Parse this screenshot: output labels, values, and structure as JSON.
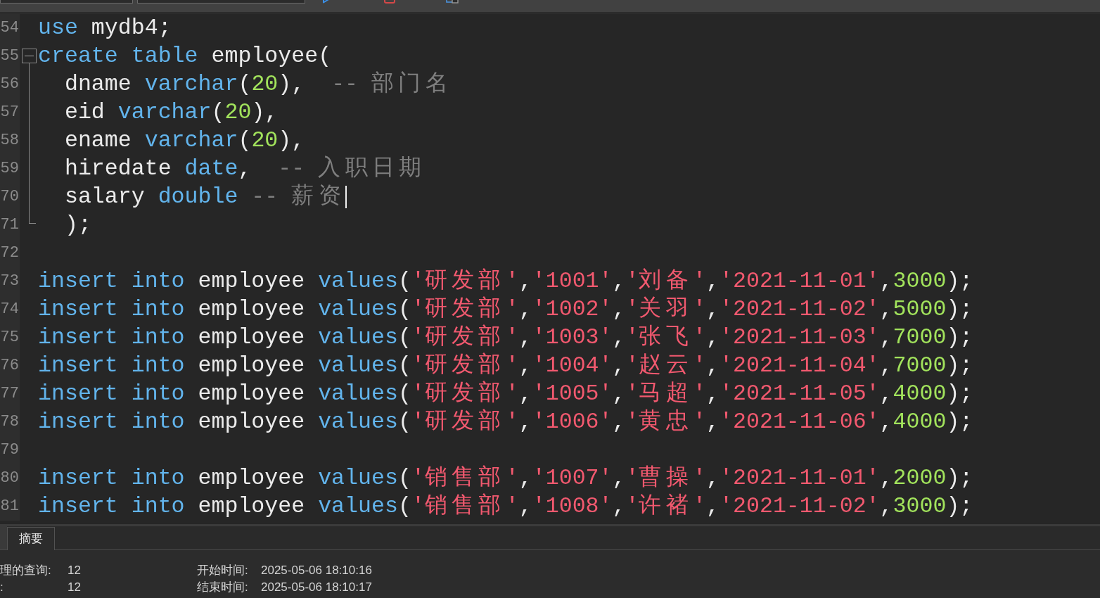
{
  "toolbar": {
    "fields": [
      {
        "kind": "select"
      },
      {
        "kind": "select"
      }
    ],
    "buttons": [
      {
        "kind": "run"
      },
      {
        "kind": "stop"
      },
      {
        "kind": "explain"
      }
    ]
  },
  "editor": {
    "lines": [
      {
        "number": "54",
        "kind": "plain",
        "tokens": [
          {
            "kind": "keyword",
            "text": "use"
          },
          {
            "kind": "plain",
            "text": " mydb4;"
          }
        ]
      },
      {
        "number": "55",
        "kind": "foldstart",
        "tokens": [
          {
            "kind": "keyword",
            "text": "create"
          },
          {
            "kind": "keyword",
            "text": " table"
          },
          {
            "kind": "plain",
            "text": " employee("
          }
        ]
      },
      {
        "number": "56",
        "kind": "foldbody",
        "tokens": [
          {
            "kind": "plain",
            "text": "  dname "
          },
          {
            "kind": "keyword",
            "text": "varchar"
          },
          {
            "kind": "plain",
            "text": "("
          },
          {
            "kind": "number",
            "text": "20"
          },
          {
            "kind": "plain",
            "text": "),  "
          },
          {
            "kind": "comment",
            "text": "-- 部门名"
          }
        ]
      },
      {
        "number": "57",
        "kind": "foldbody",
        "tokens": [
          {
            "kind": "plain",
            "text": "  eid "
          },
          {
            "kind": "keyword",
            "text": "varchar"
          },
          {
            "kind": "plain",
            "text": "("
          },
          {
            "kind": "number",
            "text": "20"
          },
          {
            "kind": "plain",
            "text": "),"
          }
        ]
      },
      {
        "number": "58",
        "kind": "foldbody",
        "tokens": [
          {
            "kind": "plain",
            "text": "  ename "
          },
          {
            "kind": "keyword",
            "text": "varchar"
          },
          {
            "kind": "plain",
            "text": "("
          },
          {
            "kind": "number",
            "text": "20"
          },
          {
            "kind": "plain",
            "text": "),"
          }
        ]
      },
      {
        "number": "59",
        "kind": "foldbody",
        "tokens": [
          {
            "kind": "plain",
            "text": "  hiredate "
          },
          {
            "kind": "keyword",
            "text": "date"
          },
          {
            "kind": "plain",
            "text": ",  "
          },
          {
            "kind": "comment",
            "text": "-- 入职日期"
          }
        ]
      },
      {
        "number": "70",
        "kind": "foldbody",
        "tokens": [
          {
            "kind": "plain",
            "text": "  salary "
          },
          {
            "kind": "keyword",
            "text": "double"
          },
          {
            "kind": "comment",
            "text": " -- 薪资"
          },
          {
            "kind": "cursor"
          }
        ]
      },
      {
        "number": "71",
        "kind": "foldend",
        "tokens": [
          {
            "kind": "plain",
            "text": "  );"
          }
        ]
      },
      {
        "number": "72",
        "kind": "plain"
      },
      {
        "number": "73",
        "kind": "plain",
        "tokens": [
          {
            "kind": "keyword",
            "text": "insert"
          },
          {
            "kind": "keyword",
            "text": " into"
          },
          {
            "kind": "plain",
            "text": " employee "
          },
          {
            "kind": "keyword",
            "text": "values"
          },
          {
            "kind": "plain",
            "text": "("
          },
          {
            "kind": "string",
            "text": "'研发部'"
          },
          {
            "kind": "plain",
            "text": ","
          },
          {
            "kind": "string",
            "text": "'1001'"
          },
          {
            "kind": "plain",
            "text": ","
          },
          {
            "kind": "string",
            "text": "'刘备'"
          },
          {
            "kind": "plain",
            "text": ","
          },
          {
            "kind": "string",
            "text": "'2021-11-01'"
          },
          {
            "kind": "plain",
            "text": ","
          },
          {
            "kind": "number",
            "text": "3000"
          },
          {
            "kind": "plain",
            "text": ");"
          }
        ]
      },
      {
        "number": "74",
        "kind": "plain",
        "tokens": [
          {
            "kind": "keyword",
            "text": "insert"
          },
          {
            "kind": "keyword",
            "text": " into"
          },
          {
            "kind": "plain",
            "text": " employee "
          },
          {
            "kind": "keyword",
            "text": "values"
          },
          {
            "kind": "plain",
            "text": "("
          },
          {
            "kind": "string",
            "text": "'研发部'"
          },
          {
            "kind": "plain",
            "text": ","
          },
          {
            "kind": "string",
            "text": "'1002'"
          },
          {
            "kind": "plain",
            "text": ","
          },
          {
            "kind": "string",
            "text": "'关羽'"
          },
          {
            "kind": "plain",
            "text": ","
          },
          {
            "kind": "string",
            "text": "'2021-11-02'"
          },
          {
            "kind": "plain",
            "text": ","
          },
          {
            "kind": "number",
            "text": "5000"
          },
          {
            "kind": "plain",
            "text": ");"
          }
        ]
      },
      {
        "number": "75",
        "kind": "plain",
        "tokens": [
          {
            "kind": "keyword",
            "text": "insert"
          },
          {
            "kind": "keyword",
            "text": " into"
          },
          {
            "kind": "plain",
            "text": " employee "
          },
          {
            "kind": "keyword",
            "text": "values"
          },
          {
            "kind": "plain",
            "text": "("
          },
          {
            "kind": "string",
            "text": "'研发部'"
          },
          {
            "kind": "plain",
            "text": ","
          },
          {
            "kind": "string",
            "text": "'1003'"
          },
          {
            "kind": "plain",
            "text": ","
          },
          {
            "kind": "string",
            "text": "'张飞'"
          },
          {
            "kind": "plain",
            "text": ","
          },
          {
            "kind": "string",
            "text": "'2021-11-03'"
          },
          {
            "kind": "plain",
            "text": ","
          },
          {
            "kind": "number",
            "text": "7000"
          },
          {
            "kind": "plain",
            "text": ");"
          }
        ]
      },
      {
        "number": "76",
        "kind": "plain",
        "tokens": [
          {
            "kind": "keyword",
            "text": "insert"
          },
          {
            "kind": "keyword",
            "text": " into"
          },
          {
            "kind": "plain",
            "text": " employee "
          },
          {
            "kind": "keyword",
            "text": "values"
          },
          {
            "kind": "plain",
            "text": "("
          },
          {
            "kind": "string",
            "text": "'研发部'"
          },
          {
            "kind": "plain",
            "text": ","
          },
          {
            "kind": "string",
            "text": "'1004'"
          },
          {
            "kind": "plain",
            "text": ","
          },
          {
            "kind": "string",
            "text": "'赵云'"
          },
          {
            "kind": "plain",
            "text": ","
          },
          {
            "kind": "string",
            "text": "'2021-11-04'"
          },
          {
            "kind": "plain",
            "text": ","
          },
          {
            "kind": "number",
            "text": "7000"
          },
          {
            "kind": "plain",
            "text": ");"
          }
        ]
      },
      {
        "number": "77",
        "kind": "plain",
        "tokens": [
          {
            "kind": "keyword",
            "text": "insert"
          },
          {
            "kind": "keyword",
            "text": " into"
          },
          {
            "kind": "plain",
            "text": " employee "
          },
          {
            "kind": "keyword",
            "text": "values"
          },
          {
            "kind": "plain",
            "text": "("
          },
          {
            "kind": "string",
            "text": "'研发部'"
          },
          {
            "kind": "plain",
            "text": ","
          },
          {
            "kind": "string",
            "text": "'1005'"
          },
          {
            "kind": "plain",
            "text": ","
          },
          {
            "kind": "string",
            "text": "'马超'"
          },
          {
            "kind": "plain",
            "text": ","
          },
          {
            "kind": "string",
            "text": "'2021-11-05'"
          },
          {
            "kind": "plain",
            "text": ","
          },
          {
            "kind": "number",
            "text": "4000"
          },
          {
            "kind": "plain",
            "text": ");"
          }
        ]
      },
      {
        "number": "78",
        "kind": "plain",
        "tokens": [
          {
            "kind": "keyword",
            "text": "insert"
          },
          {
            "kind": "keyword",
            "text": " into"
          },
          {
            "kind": "plain",
            "text": " employee "
          },
          {
            "kind": "keyword",
            "text": "values"
          },
          {
            "kind": "plain",
            "text": "("
          },
          {
            "kind": "string",
            "text": "'研发部'"
          },
          {
            "kind": "plain",
            "text": ","
          },
          {
            "kind": "string",
            "text": "'1006'"
          },
          {
            "kind": "plain",
            "text": ","
          },
          {
            "kind": "string",
            "text": "'黄忠'"
          },
          {
            "kind": "plain",
            "text": ","
          },
          {
            "kind": "string",
            "text": "'2021-11-06'"
          },
          {
            "kind": "plain",
            "text": ","
          },
          {
            "kind": "number",
            "text": "4000"
          },
          {
            "kind": "plain",
            "text": ");"
          }
        ]
      },
      {
        "number": "79",
        "kind": "plain"
      },
      {
        "number": "80",
        "kind": "plain",
        "tokens": [
          {
            "kind": "keyword",
            "text": "insert"
          },
          {
            "kind": "keyword",
            "text": " into"
          },
          {
            "kind": "plain",
            "text": " employee "
          },
          {
            "kind": "keyword",
            "text": "values"
          },
          {
            "kind": "plain",
            "text": "("
          },
          {
            "kind": "string",
            "text": "'销售部'"
          },
          {
            "kind": "plain",
            "text": ","
          },
          {
            "kind": "string",
            "text": "'1007'"
          },
          {
            "kind": "plain",
            "text": ","
          },
          {
            "kind": "string",
            "text": "'曹操'"
          },
          {
            "kind": "plain",
            "text": ","
          },
          {
            "kind": "string",
            "text": "'2021-11-01'"
          },
          {
            "kind": "plain",
            "text": ","
          },
          {
            "kind": "number",
            "text": "2000"
          },
          {
            "kind": "plain",
            "text": ");"
          }
        ]
      },
      {
        "number": "81",
        "kind": "plain",
        "tokens": [
          {
            "kind": "keyword",
            "text": "insert"
          },
          {
            "kind": "keyword",
            "text": " into"
          },
          {
            "kind": "plain",
            "text": " employee "
          },
          {
            "kind": "keyword",
            "text": "values"
          },
          {
            "kind": "plain",
            "text": "("
          },
          {
            "kind": "string",
            "text": "'销售部'"
          },
          {
            "kind": "plain",
            "text": ","
          },
          {
            "kind": "string",
            "text": "'1008'"
          },
          {
            "kind": "plain",
            "text": ","
          },
          {
            "kind": "string",
            "text": "'许褚'"
          },
          {
            "kind": "plain",
            "text": ","
          },
          {
            "kind": "string",
            "text": "'2021-11-02'"
          },
          {
            "kind": "plain",
            "text": ","
          },
          {
            "kind": "number",
            "text": "3000"
          },
          {
            "kind": "plain",
            "text": ");"
          }
        ]
      }
    ]
  },
  "bottom_panel": {
    "tabs": [
      {
        "selected": false
      },
      {
        "label": "摘要",
        "selected": true
      }
    ],
    "rows": [
      {
        "label": "理的查询:",
        "value": "12",
        "time_label": "开始时间:",
        "time_value": "2025-05-06 18:10:16"
      },
      {
        "label": ":",
        "value": "12",
        "time_label": "结束时间:",
        "time_value": "2025-05-06 18:10:17"
      }
    ]
  }
}
